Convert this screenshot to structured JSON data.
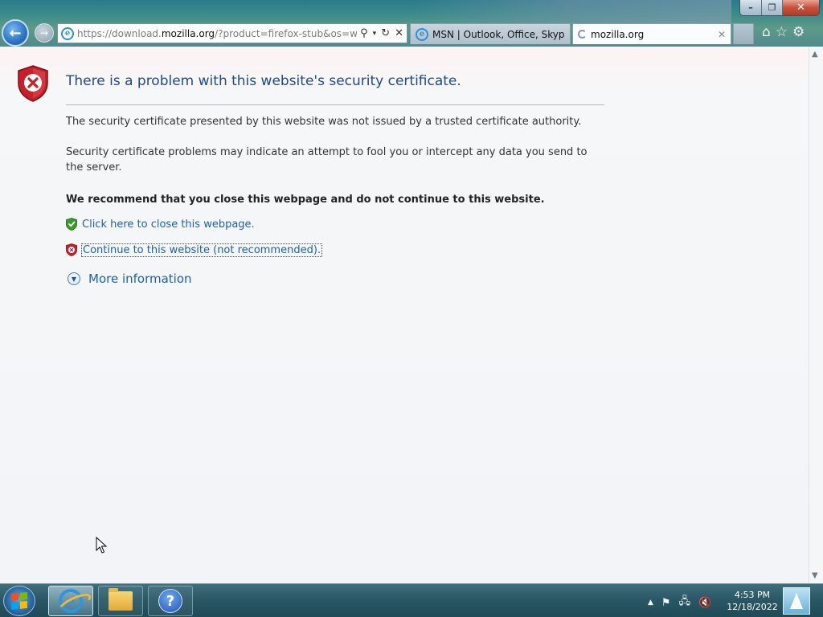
{
  "window": {
    "minimize_label": "–",
    "restore_label": "❐",
    "close_label": "✕"
  },
  "address_bar": {
    "url_prefix": "https://download.",
    "url_host": "mozilla.org",
    "url_suffix": "/?product=firefox-stub&os=win&l"
  },
  "tabs": [
    {
      "label": "MSN | Outlook, Office, Skype, ...",
      "active": false
    },
    {
      "label": "mozilla.org",
      "active": true
    }
  ],
  "page": {
    "title": "There is a problem with this website's security certificate.",
    "paragraph1": "The security certificate presented by this website was not issued by a trusted certificate authority.",
    "paragraph2": "Security certificate problems may indicate an attempt to fool you or intercept any data you send to the server.",
    "recommendation": "We recommend that you close this webpage and do not continue to this website.",
    "close_link": "Click here to close this webpage.",
    "continue_link": "Continue to this website (not recommended).",
    "more_info": "More information"
  },
  "taskbar": {
    "clock_time": "4:53 PM",
    "clock_date": "12/18/2022"
  },
  "colors": {
    "title_blue": "#1d4a8b",
    "link_blue": "#1e60b0",
    "shield_red": "#c8202a",
    "shield_green": "#3a9a2a"
  },
  "icons": [
    "back-icon",
    "forward-icon",
    "ie-icon",
    "search-icon",
    "refresh-icon",
    "stop-icon",
    "home-icon",
    "favorites-icon",
    "tools-icon",
    "error-shield-icon",
    "ok-shield-icon",
    "expand-icon",
    "start-orb",
    "folder-icon",
    "help-icon",
    "flag-icon",
    "network-icon",
    "mute-icon"
  ]
}
